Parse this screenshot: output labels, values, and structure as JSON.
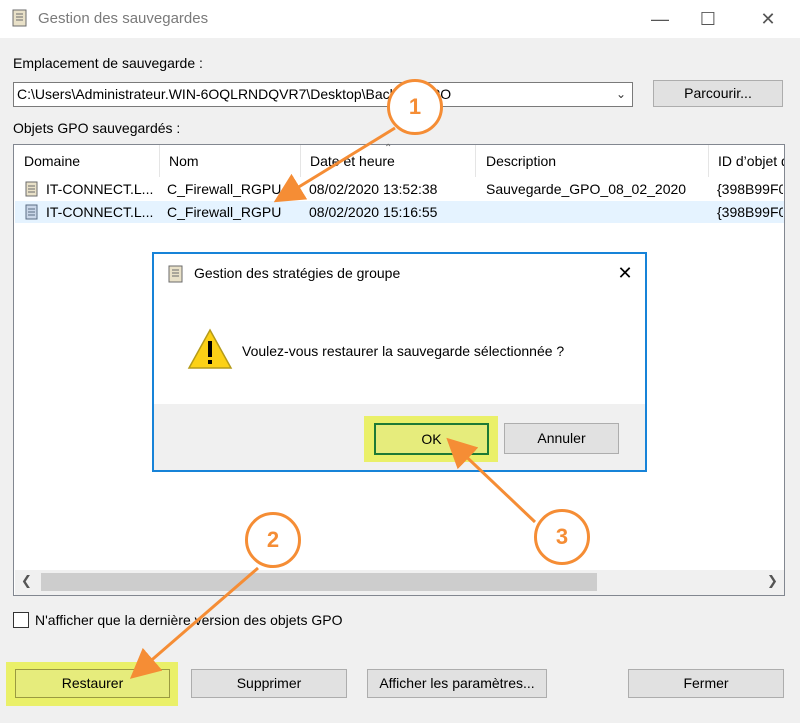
{
  "window": {
    "title": "Gestion des sauvegardes",
    "icon": "scroll-icon",
    "controls": [
      "minimize-icon",
      "maximize-icon",
      "close-icon"
    ]
  },
  "location": {
    "label": "Emplacement de sauvegarde :",
    "value": "C:\\Users\\Administrateur.WIN-6OQLRNDQVR7\\Desktop\\Backup_GPO",
    "browse_label": "Parcourir..."
  },
  "objects": {
    "label": "Objets GPO sauvegardés :"
  },
  "columns": [
    "Domaine",
    "Nom",
    "Date et heure",
    "Description",
    "ID d’objet d"
  ],
  "rows": [
    {
      "domain": "IT-CONNECT.L...",
      "name": "C_Firewall_RGPU",
      "date": "08/02/2020 13:52:38",
      "description": "Sauvegarde_GPO_08_02_2020",
      "id": "{398B99F0"
    },
    {
      "domain": "IT-CONNECT.L...",
      "name": "C_Firewall_RGPU",
      "date": "08/02/2020 15:16:55",
      "description": "",
      "id": "{398B99F0"
    }
  ],
  "checkbox": {
    "label": "N'afficher que la dernière version des objets GPO",
    "checked": false
  },
  "buttons": {
    "restore": "Restaurer",
    "delete": "Supprimer",
    "show_params": "Afficher les paramètres...",
    "close": "Fermer"
  },
  "dialog": {
    "title": "Gestion des stratégies de groupe",
    "message": "Voulez-vous restaurer la sauvegarde sélectionnée ?",
    "ok": "OK",
    "cancel": "Annuler"
  },
  "annotations": [
    "1",
    "2",
    "3"
  ],
  "colors": {
    "annotation": "#f58d35",
    "highlight": "#e8f03c",
    "dialog_border": "#1783d8",
    "selected_row": "#e5f3ff",
    "ok_border": "#1e7a35"
  }
}
